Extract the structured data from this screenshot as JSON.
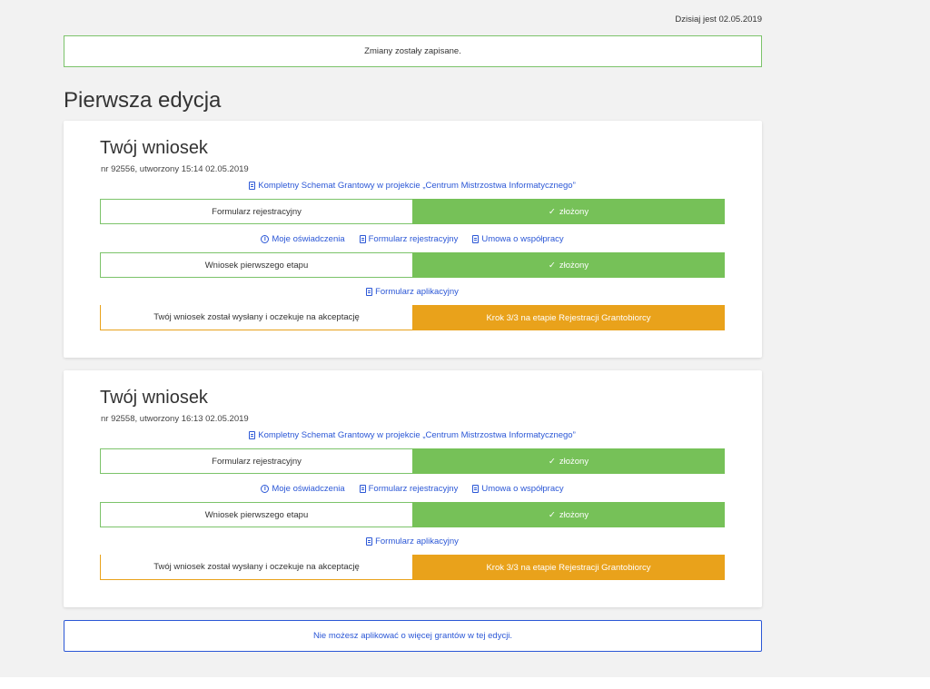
{
  "header": {
    "date_text": "Dzisiaj jest 02.05.2019"
  },
  "alert_success": "Zmiany zostały zapisane.",
  "edition_title": "Pierwsza edycja",
  "applications": [
    {
      "title": "Twój wniosek",
      "subtitle": "nr 92556, utworzony 15:14 02.05.2019",
      "scheme_link": "Kompletny Schemat Grantowy w projekcie „Centrum Mistrzostwa Informatycznego”",
      "rows": [
        {
          "label": "Formularz rejestracyjny",
          "status": "złożony",
          "status_icon": "check-icon",
          "state": "done"
        },
        {
          "label": "Wniosek pierwszego etapu",
          "status": "złożony",
          "status_icon": "check-icon",
          "state": "done"
        },
        {
          "label": "Twój wniosek został wysłany i oczekuje na akceptację",
          "status": "Krok 3/3 na etapie Rejestracji Grantobiorcy",
          "state": "pending"
        }
      ],
      "links_row1": [
        "Moje oświadczenia",
        "Formularz rejestracyjny",
        "Umowa o współpracy"
      ],
      "links_row2": [
        "Formularz aplikacyjny"
      ]
    },
    {
      "title": "Twój wniosek",
      "subtitle": "nr 92558, utworzony 16:13 02.05.2019",
      "scheme_link": "Kompletny Schemat Grantowy w projekcie „Centrum Mistrzostwa Informatycznego”",
      "rows": [
        {
          "label": "Formularz rejestracyjny",
          "status": "złożony",
          "status_icon": "check-icon",
          "state": "done"
        },
        {
          "label": "Wniosek pierwszego etapu",
          "status": "złożony",
          "status_icon": "check-icon",
          "state": "done"
        },
        {
          "label": "Twój wniosek został wysłany i oczekuje na akceptację",
          "status": "Krok 3/3 na etapie Rejestracji Grantobiorcy",
          "state": "pending"
        }
      ],
      "links_row1": [
        "Moje oświadczenia",
        "Formularz rejestracyjny",
        "Umowa o współpracy"
      ],
      "links_row2": [
        "Formularz aplikacyjny"
      ]
    }
  ],
  "alert_info": "Nie możesz aplikować o więcej grantów w tej edycji.",
  "colors": {
    "success": "#76c158",
    "warning": "#e9a21b",
    "link": "#2b57d6",
    "background": "#f2f2f2"
  }
}
